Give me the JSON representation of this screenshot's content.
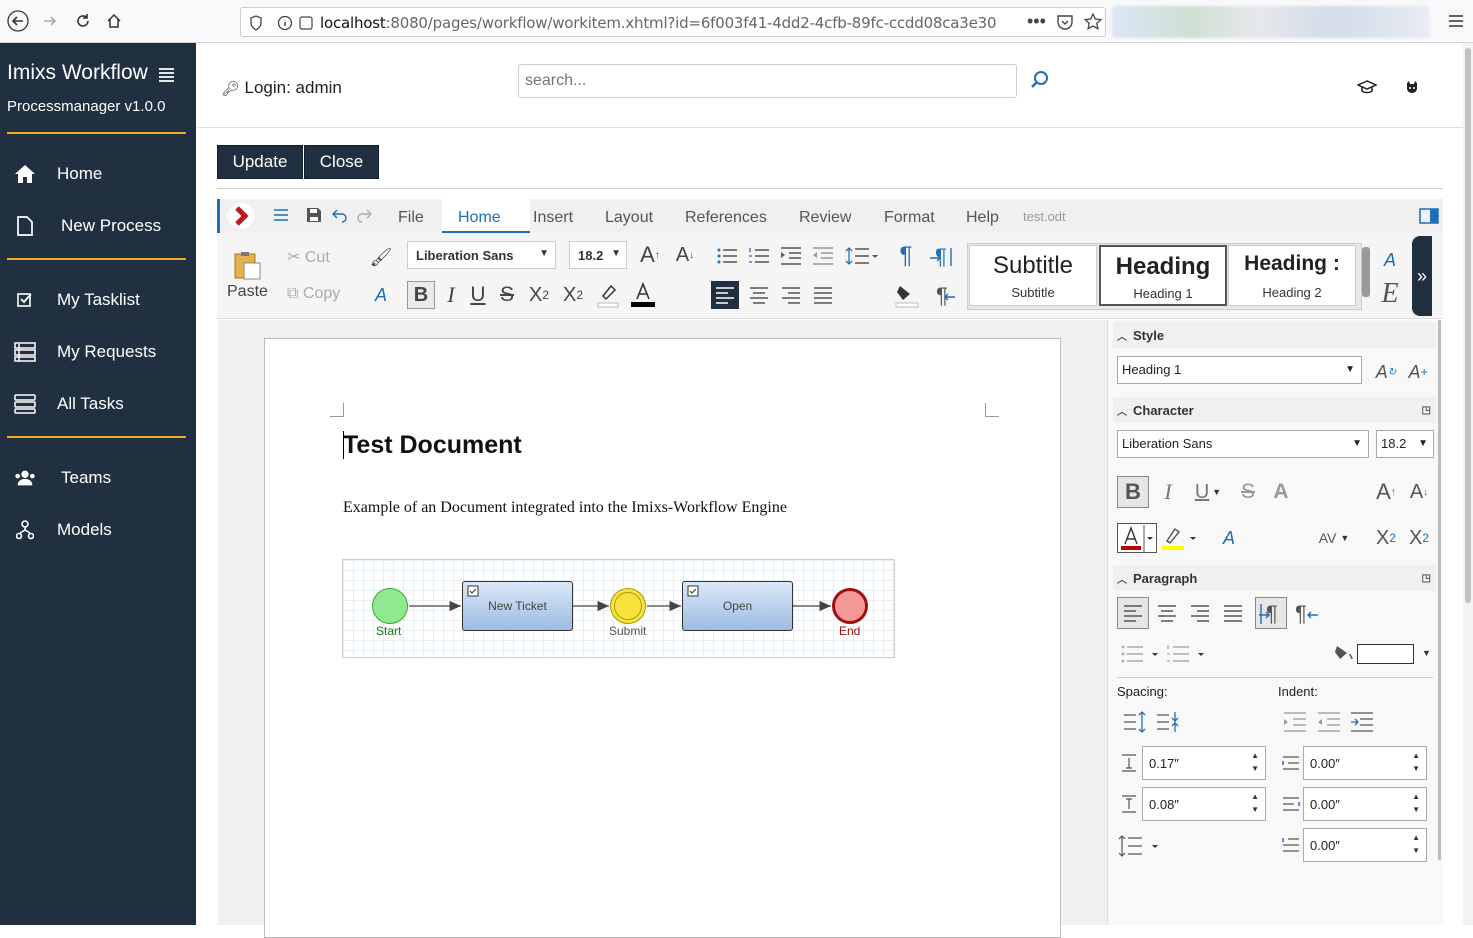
{
  "browser": {
    "url_host": "localhost",
    "url_path": ":8080/pages/workflow/workitem.xhtml?id=6f003f41-4dd2-4cfb-89fc-ccdd08ca3e30"
  },
  "sidebar": {
    "brand": "Imixs Workflow",
    "version": "Processmanager v1.0.0",
    "items": [
      {
        "label": "Home",
        "icon": "home-icon"
      },
      {
        "label": "New Process",
        "icon": "document-icon"
      },
      {
        "label": "My Tasklist",
        "icon": "checkbox-icon"
      },
      {
        "label": "My Requests",
        "icon": "list-icon"
      },
      {
        "label": "All Tasks",
        "icon": "stack-icon"
      },
      {
        "label": "Teams",
        "icon": "users-icon"
      },
      {
        "label": "Models",
        "icon": "hierarchy-icon"
      }
    ],
    "accent": "#f5a623",
    "background": "#203040"
  },
  "header": {
    "login": "Login: admin",
    "search_placeholder": "search..."
  },
  "actions": {
    "update": "Update",
    "close": "Close"
  },
  "office": {
    "menus": [
      "File",
      "Home",
      "Insert",
      "Layout",
      "References",
      "Review",
      "Format",
      "Help"
    ],
    "active_menu": "Home",
    "filename": "test.odt",
    "paste": "Paste",
    "cut": "Cut",
    "copy": "Copy",
    "font": "Liberation Sans",
    "size": "18.2",
    "styles": [
      {
        "preview": "Subtitle",
        "name": "Subtitle"
      },
      {
        "preview": "Heading",
        "name": "Heading 1"
      },
      {
        "preview": "Heading :",
        "name": "Heading 2"
      }
    ],
    "accent": "#1e6fb8"
  },
  "document": {
    "title": "Test Document",
    "body": "Example of an Document integrated into the Imixs-Workflow Engine",
    "diagram": {
      "start": "Start",
      "task1": "New Ticket",
      "event": "Submit",
      "task2": "Open",
      "end": "End"
    }
  },
  "panel": {
    "style_header": "Style",
    "style_value": "Heading 1",
    "character_header": "Character",
    "char_font": "Liberation Sans",
    "char_size": "18.2",
    "paragraph_header": "Paragraph",
    "spacing_label": "Spacing:",
    "indent_label": "Indent:",
    "spacing_above": "0.17″",
    "spacing_below": "0.08″",
    "indent_before": "0.00″",
    "indent_after": "0.00″",
    "indent_first": "0.00″"
  }
}
